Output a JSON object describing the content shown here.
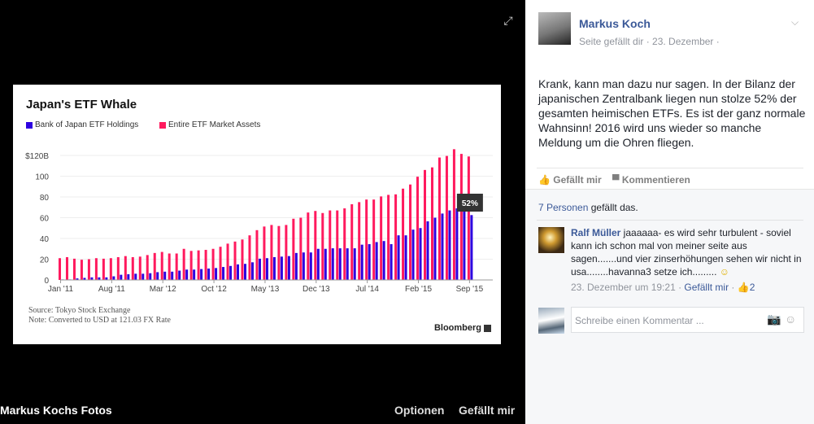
{
  "viewer": {
    "bottom_title": "Markus Kochs Fotos",
    "options": "Optionen",
    "like": "Gefällt mir",
    "expand_icon": "expand-icon"
  },
  "chart_data": {
    "type": "bar",
    "title": "Japan's ETF Whale",
    "ylim": [
      0,
      120
    ],
    "yticks": [
      "0",
      "20",
      "40",
      "60",
      "80",
      "100",
      "$120B"
    ],
    "xtick_labels": [
      "Jan '11",
      "Aug '11",
      "Mar '12",
      "Oct '12",
      "May '13",
      "Dec '13",
      "Jul '14",
      "Feb '15",
      "Sep '15"
    ],
    "start_month": "Jan 2011",
    "series": [
      {
        "name": "Bank of Japan ETF Holdings",
        "color": "#2d00e0",
        "values": [
          0.5,
          0.5,
          1.5,
          2,
          2.5,
          2.5,
          2.5,
          3.5,
          5,
          5.5,
          6,
          6,
          6.5,
          7.5,
          8,
          8,
          9,
          10,
          10,
          10.5,
          11,
          11.5,
          12.5,
          13.5,
          15,
          15.5,
          17,
          20.5,
          21,
          22,
          22.5,
          23,
          26,
          26.5,
          26.5,
          30,
          30,
          30.5,
          30.5,
          30.5,
          30.5,
          34,
          34.5,
          36.5,
          37.5,
          34.5,
          43,
          43,
          48.5,
          50,
          56.5,
          60,
          64,
          67,
          69,
          69,
          62.5
        ]
      },
      {
        "name": "Entire ETF Market Assets",
        "color": "#ff1a5e",
        "values": [
          21,
          22,
          20.5,
          19.5,
          20,
          21,
          20.5,
          21,
          22,
          23,
          22,
          22.5,
          24,
          26,
          27,
          25.5,
          25.5,
          30,
          28,
          28.5,
          29,
          30,
          32,
          35,
          37,
          39,
          43,
          48,
          51.5,
          53,
          52,
          53,
          59,
          60,
          65,
          66.5,
          64.5,
          67,
          67,
          69,
          73,
          75,
          77.5,
          77.5,
          80.5,
          82,
          82.5,
          88,
          92,
          99.5,
          106,
          108.5,
          118,
          119.5,
          126,
          121.5,
          119
        ]
      }
    ],
    "annotation": "52%",
    "source": "Source: Tokyo Stock Exchange",
    "note": "Note: Converted to USD at 121.03 FX Rate",
    "logo": "Bloomberg",
    "grid": true
  },
  "post": {
    "author": "Markus Koch",
    "meta": "Seite gefällt dir · 23. Dezember ·",
    "text": "Krank, kann man dazu nur sagen. In der Bilanz der japanischen Zentralbank liegen nun stolze 52% der gesamten heimischen ETFs. Es ist der ganz normale Wahnsinn! 2016 wird uns wieder so manche Meldung um die Ohren fliegen.",
    "like": "Gefällt mir",
    "comment": "Kommentieren",
    "likes_link": "7 Personen",
    "likes_rest": " gefällt das."
  },
  "comment": {
    "author": "Ralf Müller",
    "text": " jaaaaaa- es wird sehr turbulent - soviel kann ich schon mal von meiner seite aus sagen.......und vier zinserhöhungen sehen wir nicht in usa........havanna3 setze ich.........",
    "time": "23. Dezember um 19:21 · ",
    "like": "Gefällt mir",
    "sep": " · ",
    "like_count": "2"
  },
  "write": {
    "placeholder": "Schreibe einen Kommentar ..."
  }
}
